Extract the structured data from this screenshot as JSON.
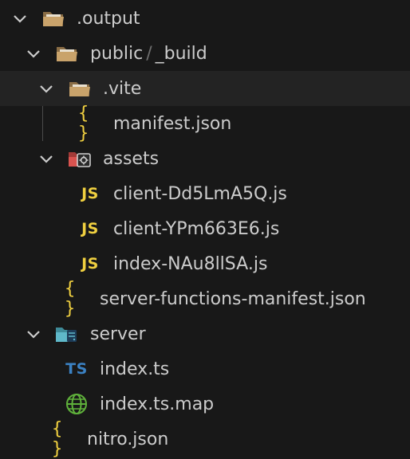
{
  "explorer": {
    "output": {
      "label": ".output",
      "icon": "folder-open-icon"
    },
    "public": {
      "label": "public",
      "separator": "/",
      "sublabel": "_build",
      "icon": "folder-open-icon"
    },
    "vite": {
      "label": ".vite",
      "icon": "folder-open-icon"
    },
    "manifest": {
      "label": "manifest.json",
      "icon": "json-braces-icon",
      "glyph": "{ }"
    },
    "assets": {
      "label": "assets",
      "icon": "assets-folder-icon"
    },
    "files": [
      {
        "label": "client-Dd5LmA5Q.js",
        "icon": "javascript-icon",
        "glyph": "JS"
      },
      {
        "label": "client-YPm663E6.js",
        "icon": "javascript-icon",
        "glyph": "JS"
      },
      {
        "label": "index-NAu8llSA.js",
        "icon": "javascript-icon",
        "glyph": "JS"
      }
    ],
    "server_functions": {
      "label": "server-functions-manifest.json",
      "icon": "json-braces-icon",
      "glyph": "{ }"
    },
    "server": {
      "label": "server",
      "icon": "server-folder-icon"
    },
    "index_ts": {
      "label": "index.ts",
      "icon": "typescript-icon",
      "glyph": "TS"
    },
    "index_map": {
      "label": "index.ts.map",
      "icon": "globe-icon"
    },
    "nitro": {
      "label": "nitro.json",
      "icon": "json-braces-icon",
      "glyph": "{ }"
    }
  },
  "colors": {
    "background": "#181818",
    "hover_row": "#232323",
    "text": "#cccccc",
    "folder": "#c9a36b",
    "json": "#f0d040",
    "javascript": "#f0d040",
    "typescript": "#3b82c4",
    "globe": "#5fb13b",
    "assets_folder": "#d9534f",
    "server_folder": "#5fb8c9"
  }
}
